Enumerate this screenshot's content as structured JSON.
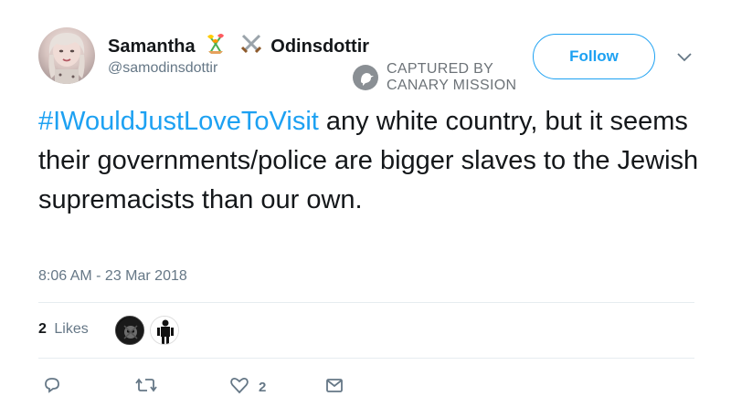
{
  "author": {
    "name_first": "Samantha",
    "name_last": "Odinsdottir",
    "emoji_icons": [
      "tulip-bouquet-icon",
      "crossed-swords-icon"
    ],
    "handle": "@samodinsdottir"
  },
  "watermark": {
    "line1": "CAPTURED BY",
    "line2": "CANARY MISSION"
  },
  "follow_button": {
    "label": "Follow"
  },
  "tweet": {
    "hashtag": "#IWouldJustLoveToVisit",
    "body": " any white country, but it seems their governments/police are bigger slaves to the Jewish supremacists than our own."
  },
  "timestamp": "8:06 AM - 23 Mar 2018",
  "stats": {
    "likes_count": "2",
    "likes_label": "Likes"
  },
  "actions": {
    "reply_count": "",
    "retweet_count": "",
    "like_count": "2",
    "dm_count": ""
  },
  "colors": {
    "accent": "#1da1f2",
    "secondary_text": "#657786",
    "primary_text": "#14171a",
    "divider": "#e6ecf0"
  }
}
